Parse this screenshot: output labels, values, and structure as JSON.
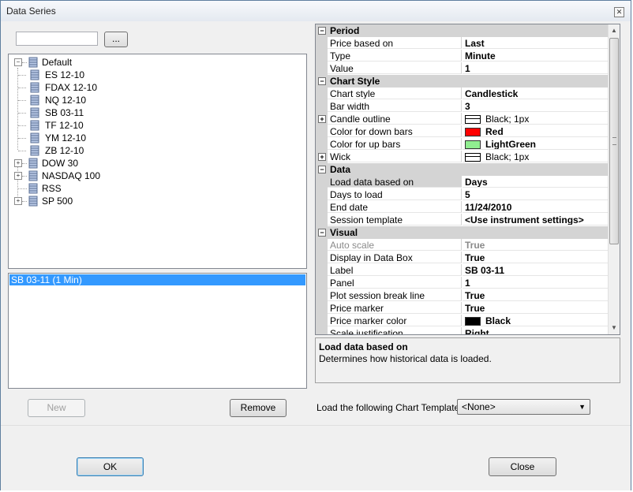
{
  "window": {
    "title": "Data Series"
  },
  "search": {
    "value": "",
    "browse_label": "..."
  },
  "tree": {
    "root": "Default",
    "children": [
      "ES 12-10",
      "FDAX 12-10",
      "NQ 12-10",
      "SB 03-11",
      "TF 12-10",
      "YM 12-10",
      "ZB 12-10"
    ],
    "groups": [
      "DOW 30",
      "NASDAQ 100",
      "RSS",
      "SP 500"
    ]
  },
  "selected_series": [
    "SB 03-11 (1 Min)"
  ],
  "buttons": {
    "new": "New",
    "remove": "Remove",
    "ok": "OK",
    "close": "Close"
  },
  "properties": {
    "period": {
      "label": "Period",
      "rows": [
        {
          "name": "Price based on",
          "value": "Last"
        },
        {
          "name": "Type",
          "value": "Minute"
        },
        {
          "name": "Value",
          "value": "1"
        }
      ]
    },
    "chart_style": {
      "label": "Chart Style",
      "rows": [
        {
          "name": "Chart style",
          "value": "Candlestick"
        },
        {
          "name": "Bar width",
          "value": "3"
        },
        {
          "name": "Candle outline",
          "value": "Black; 1px"
        },
        {
          "name": "Color for down bars",
          "value": "Red",
          "color": "#ff0000"
        },
        {
          "name": "Color for up bars",
          "value": "LightGreen",
          "color": "#90ee90"
        },
        {
          "name": "Wick",
          "value": "Black; 1px"
        }
      ]
    },
    "data": {
      "label": "Data",
      "rows": [
        {
          "name": "Load data based on",
          "value": "Days"
        },
        {
          "name": "Days to load",
          "value": "5"
        },
        {
          "name": "End date",
          "value": "11/24/2010"
        },
        {
          "name": "Session template",
          "value": "<Use instrument settings>"
        }
      ]
    },
    "visual": {
      "label": "Visual",
      "rows": [
        {
          "name": "Auto scale",
          "value": "True"
        },
        {
          "name": "Display in Data Box",
          "value": "True"
        },
        {
          "name": "Label",
          "value": "SB 03-11"
        },
        {
          "name": "Panel",
          "value": "1"
        },
        {
          "name": "Plot session break line",
          "value": "True"
        },
        {
          "name": "Price marker",
          "value": "True"
        },
        {
          "name": "Price marker color",
          "value": "Black",
          "color": "#000000"
        },
        {
          "name": "Scale justification",
          "value": "Right"
        }
      ]
    }
  },
  "description": {
    "title": "Load data based on",
    "text": "Determines how historical data is loaded."
  },
  "template": {
    "label": "Load the following Chart Template:",
    "value": "<None>"
  }
}
